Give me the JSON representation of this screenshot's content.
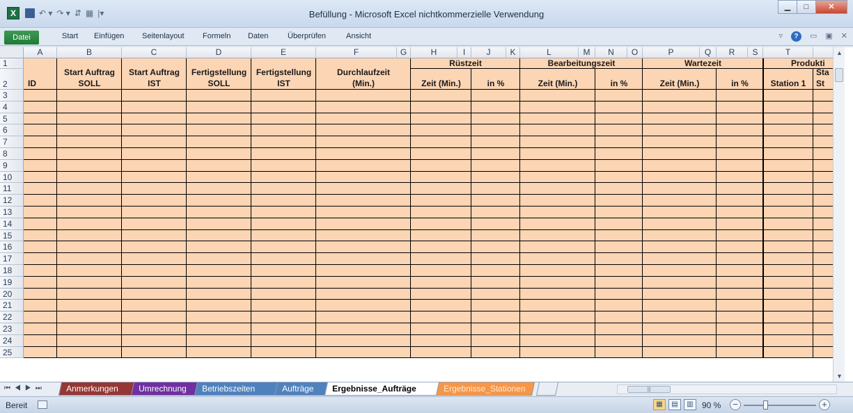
{
  "window": {
    "title": "Befüllung - Microsoft Excel nichtkommerzielle Verwendung",
    "logo": "X"
  },
  "ribbon": {
    "file_tab": "Datei",
    "tabs": [
      "Start",
      "Einfügen",
      "Seitenlayout",
      "Formeln",
      "Daten",
      "Überprüfen",
      "Ansicht"
    ]
  },
  "columns": [
    "A",
    "B",
    "C",
    "D",
    "E",
    "F",
    "G",
    "H",
    "I",
    "J",
    "K",
    "L",
    "M",
    "N",
    "O",
    "P",
    "Q",
    "R",
    "S",
    "T"
  ],
  "rows": [
    "1",
    "2",
    "3",
    "4",
    "5",
    "6",
    "7",
    "8",
    "9",
    "10",
    "11",
    "12",
    "13",
    "14",
    "15",
    "16",
    "17",
    "18",
    "19",
    "20",
    "21",
    "22",
    "23",
    "24",
    "25"
  ],
  "headers": {
    "id": "ID",
    "start_soll": [
      "Start Auftrag",
      "SOLL"
    ],
    "start_ist": [
      "Start Auftrag",
      "IST"
    ],
    "fert_soll": [
      "Fertigstellung",
      "SOLL"
    ],
    "fert_ist": [
      "Fertigstellung",
      "IST"
    ],
    "durchlauf": [
      "Durchlaufzeit",
      "(Min.)"
    ],
    "ruestzeit": "Rüstzeit",
    "bearbeitung": "Bearbeitungszeit",
    "wartezeit": "Wartezeit",
    "produktion": "Produkti",
    "zeit_min": "Zeit (Min.)",
    "in_pct": "in %",
    "station1": "Station 1",
    "sta_partial": "Sta",
    "st_partial": "St"
  },
  "sheet_tabs": [
    {
      "label": "Anmerkungen",
      "color": "#953735"
    },
    {
      "label": "Umrechnung",
      "color": "#7030a0"
    },
    {
      "label": "Betriebszeiten",
      "color": "#4f81bd"
    },
    {
      "label": "Aufträge",
      "color": "#4f81bd"
    },
    {
      "label": "Ergebnisse_Aufträge",
      "color": "#ffffff",
      "active": true
    },
    {
      "label": "Ergebnisse_Stationen",
      "color": "#f79646"
    }
  ],
  "status": {
    "ready": "Bereit",
    "zoom": "90 %"
  }
}
